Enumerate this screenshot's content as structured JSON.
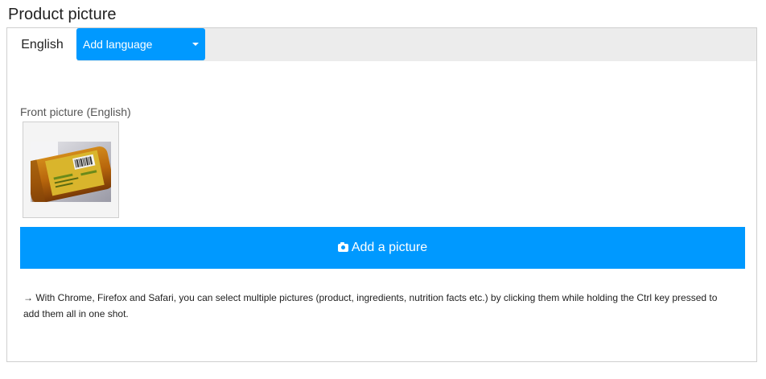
{
  "page": {
    "title": "Product picture"
  },
  "tabs": {
    "active_label": "English",
    "add_language_label": "Add language"
  },
  "front_picture": {
    "label": "Front picture (English)"
  },
  "add_picture": {
    "label": "Add a picture",
    "icon": "camera-icon"
  },
  "hint": {
    "text": "→ With Chrome, Firefox and Safari, you can select multiple pictures (product, ingredients, nutrition facts etc.) by clicking them while holding the Ctrl key pressed to add them all in one shot."
  },
  "colors": {
    "accent": "#0099ff",
    "tabbar_bg": "#ececec",
    "border": "#cfcfcf"
  }
}
